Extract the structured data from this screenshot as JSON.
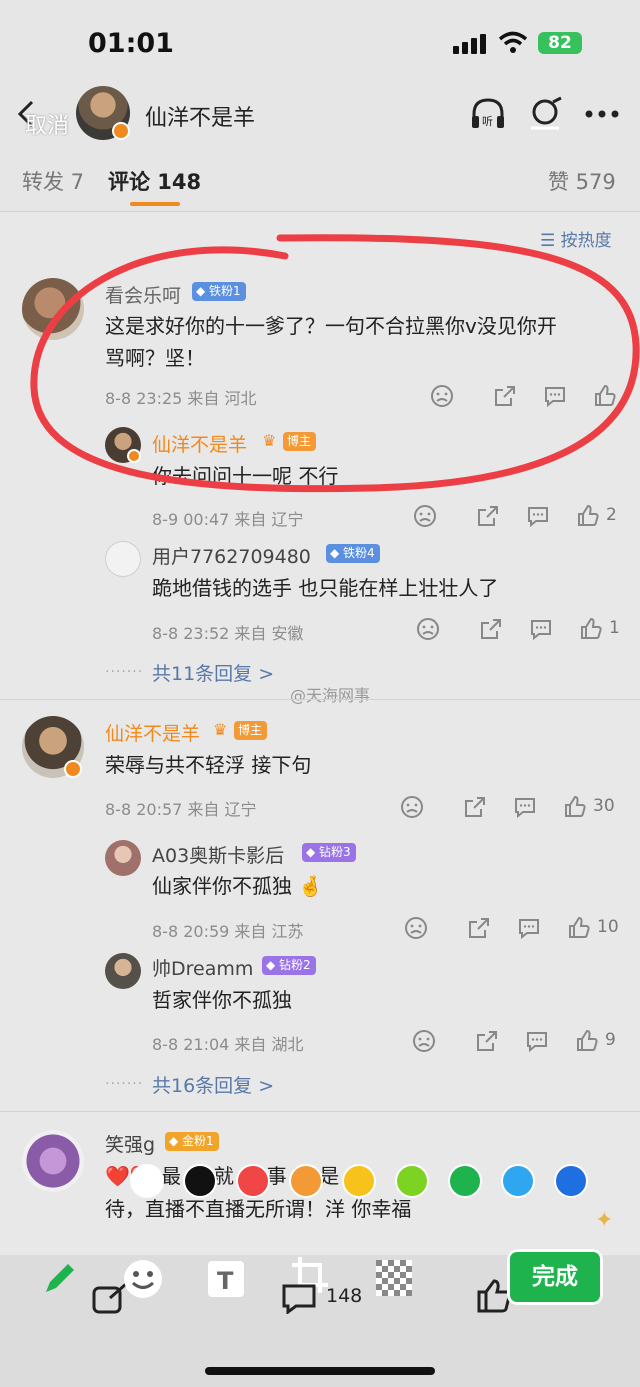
{
  "status": {
    "time": "01:01",
    "battery": "82"
  },
  "nav": {
    "cancel": "取消",
    "title": "仙洋不是羊"
  },
  "tabs": {
    "repost": "转发 7",
    "comments": "评论 148",
    "likes": "赞 579"
  },
  "sort_label": "按热度",
  "comments": [
    {
      "user": "看会乐呵",
      "badge": "铁粉1",
      "text_line1": "这是求好你的十一爹了？一句不合拉黑你v没见你开",
      "text_line2": "骂啊？坚！",
      "meta": "8-8 23:25  来自 河北",
      "replies": [
        {
          "user": "仙洋不是羊",
          "badge": "博主",
          "text": "你去问问十一呢 不行",
          "meta": "8-9 00:47  来自 辽宁",
          "likes": "2"
        },
        {
          "user": "用户7762709480",
          "badge": "铁粉4",
          "text": "跪地借钱的选手 也只能在样上壮壮人了",
          "meta": "8-8 23:52  来自 安徽",
          "likes": "1"
        }
      ],
      "more": "共11条回复 >"
    },
    {
      "user": "仙洋不是羊",
      "badge": "博主",
      "text": "荣辱与共不轻浮 接下句",
      "meta": "8-8 20:57  来自 辽宁",
      "likes": "30",
      "replies": [
        {
          "user": "A03奥斯卡影后",
          "badge": "钻粉3",
          "text": "仙家伴你不孤独 🤞",
          "meta": "8-8 20:59  来自 江苏",
          "likes": "10"
        },
        {
          "user": "帅Dreamm",
          "badge": "钻粉2",
          "text": "哲家伴你不孤独",
          "meta": "8-8 21:04  来自 湖北",
          "likes": "9"
        }
      ],
      "more": "共16条回复 >"
    },
    {
      "user": "笑强g",
      "badge": "金粉1",
      "text_line1": "❤️❤️ 最  软  就  你  事  家  是  行",
      "text_line2": "待，直播不直播无所谓！洋  你幸福"
    }
  ],
  "watermark": "@天海网事",
  "toolbar": {
    "comment_count": "148",
    "done": "完成"
  },
  "palette": [
    "#ffffff",
    "#111111",
    "#f04646",
    "#f39a36",
    "#f7c21c",
    "#7dd321",
    "#1fb34d",
    "#2ea6f0",
    "#1e6fe0"
  ]
}
